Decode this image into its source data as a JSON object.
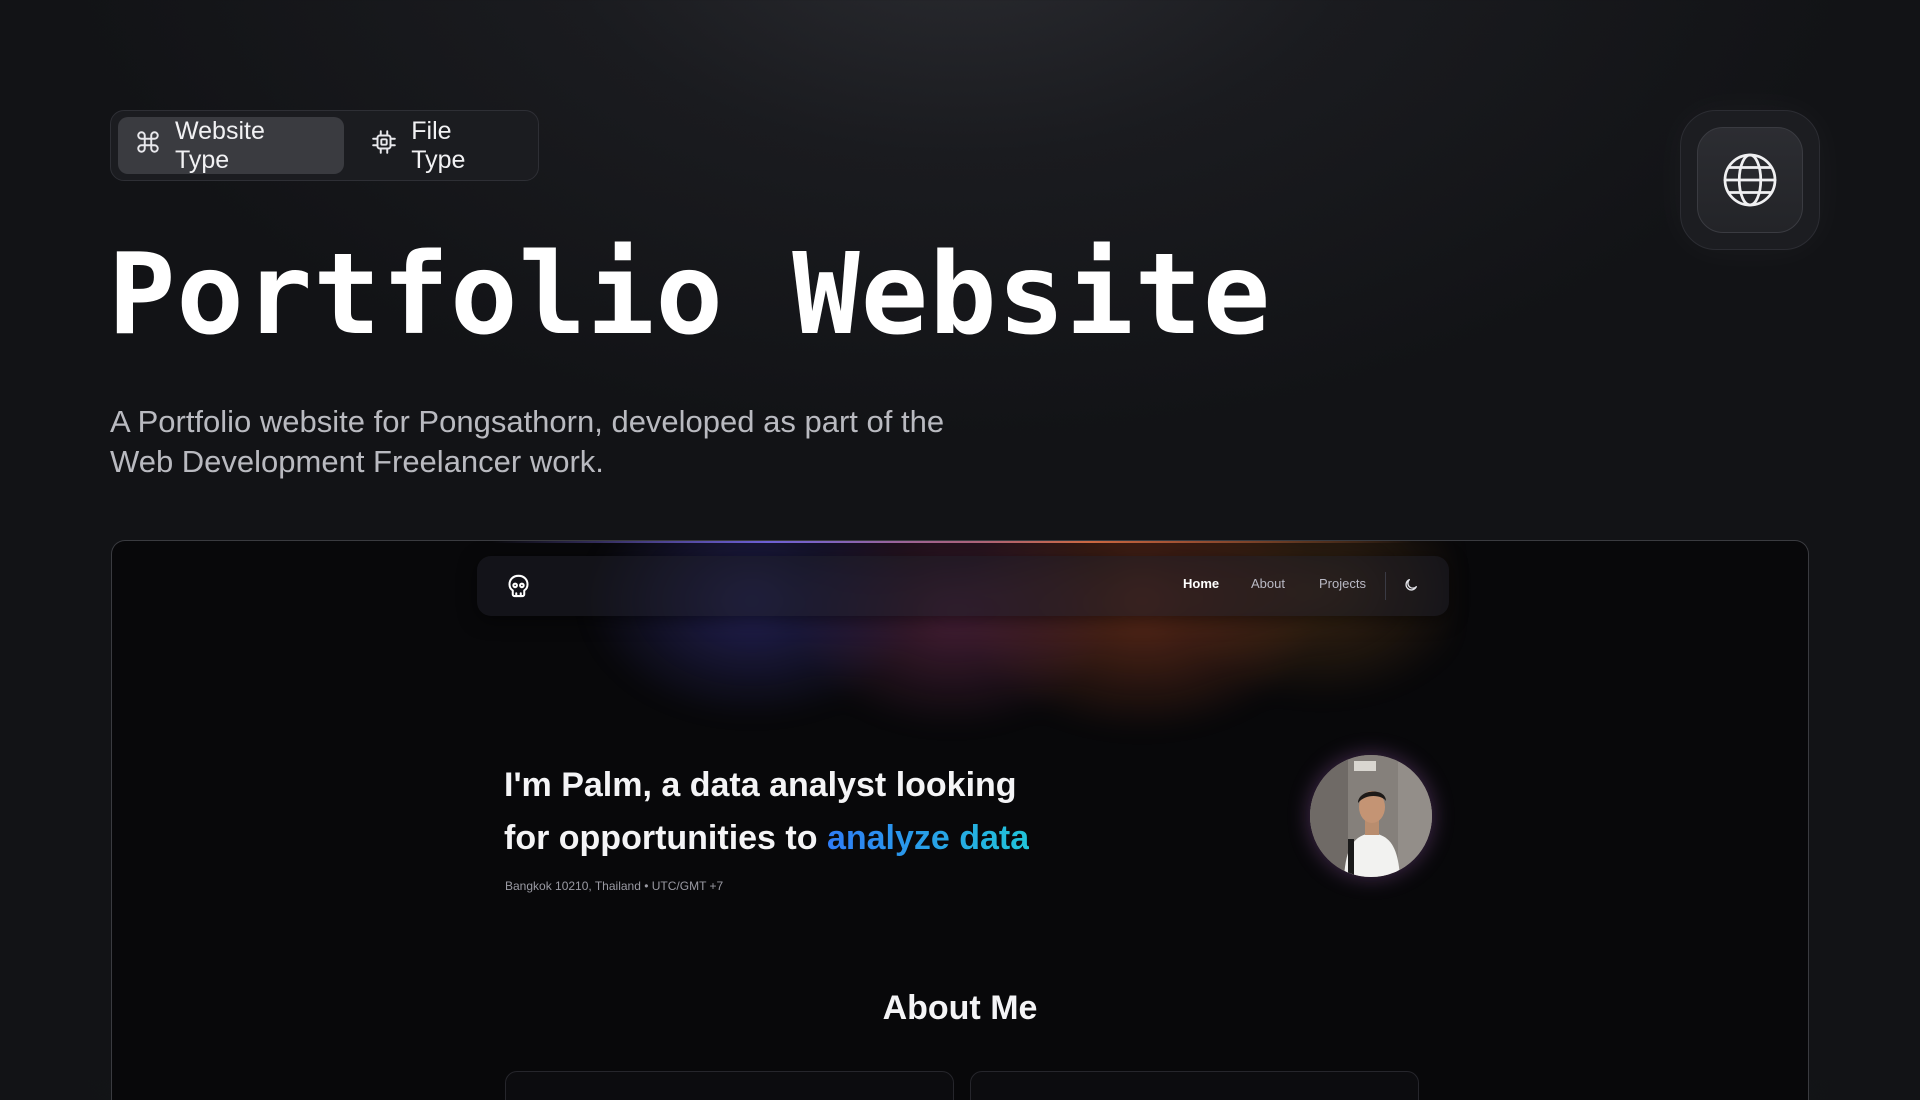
{
  "tabs": [
    {
      "label": "Website Type",
      "icon": "command-icon",
      "active": true
    },
    {
      "label": "File Type",
      "icon": "cpu-chip-icon",
      "active": false
    }
  ],
  "header": {
    "title": "Portfolio Website",
    "description": "A Portfolio website for Pongsathorn, developed as part of the Web Development Freelancer work.",
    "icon": "globe-icon"
  },
  "preview": {
    "nav": {
      "logo_icon": "skull-icon",
      "links": [
        "Home",
        "About",
        "Projects"
      ],
      "active_link": "Home",
      "theme_toggle_icon": "moon-icon"
    },
    "hero": {
      "title_line1": "I'm Palm, a data analyst looking",
      "title_line2_prefix": "for opportunities to ",
      "title_highlight": "analyze data",
      "meta": "Bangkok 10210, Thailand • UTC/GMT +7"
    },
    "about_heading": "About Me"
  },
  "colors": {
    "background": "#121316",
    "accent_gradient_start": "#2f7cf6",
    "accent_gradient_end": "#21c4d9",
    "text_primary": "#ffffff",
    "text_secondary": "#b9bac0"
  }
}
